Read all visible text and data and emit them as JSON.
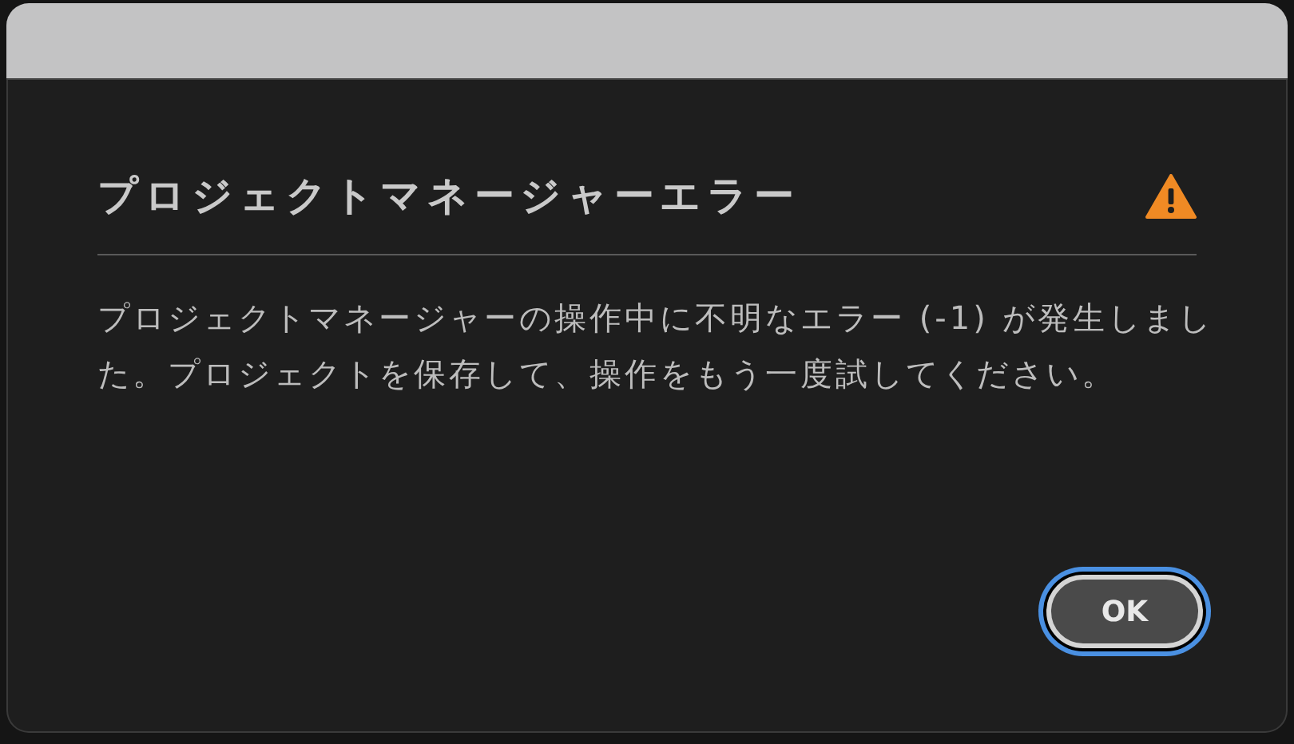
{
  "dialog": {
    "title": "プロジェクトマネージャーエラー",
    "message": "プロジェクトマネージャーの操作中に不明なエラー (-1) が発生しました。プロジェクトを保存して、操作をもう一度試してください。",
    "buttons": [
      {
        "label": "OK",
        "default": true
      }
    ]
  }
}
